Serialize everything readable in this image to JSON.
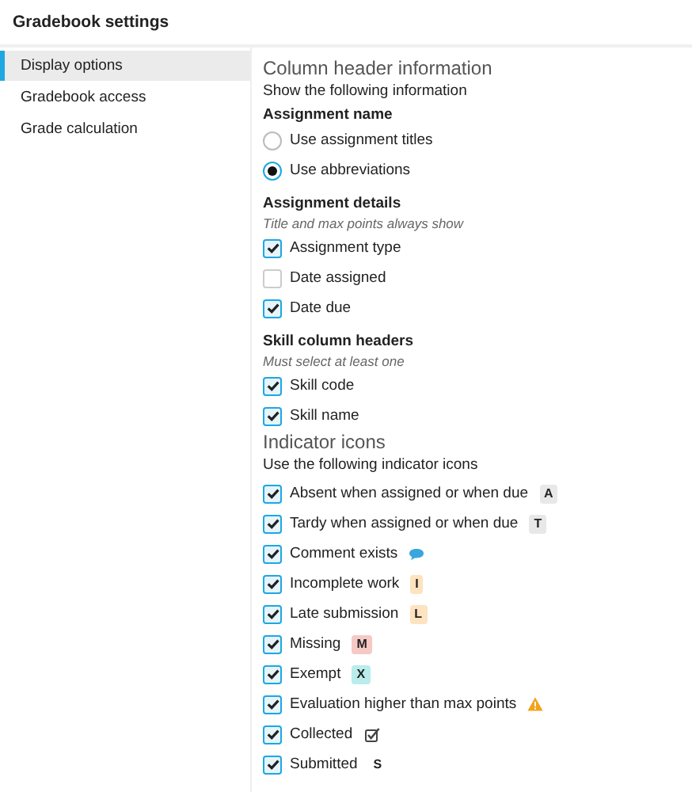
{
  "window": {
    "title": "Gradebook settings"
  },
  "sidebar": {
    "items": [
      {
        "label": "Display options",
        "selected": true
      },
      {
        "label": "Gradebook access",
        "selected": false
      },
      {
        "label": "Grade calculation",
        "selected": false
      }
    ]
  },
  "column_header": {
    "title": "Column header information",
    "subtitle": "Show the following information",
    "assignment_name": {
      "heading": "Assignment name",
      "options": [
        {
          "label": "Use assignment titles",
          "selected": false
        },
        {
          "label": "Use abbreviations",
          "selected": true
        }
      ]
    },
    "assignment_details": {
      "heading": "Assignment details",
      "note": "Title and max points always show",
      "options": [
        {
          "label": "Assignment type",
          "checked": true
        },
        {
          "label": "Date assigned",
          "checked": false
        },
        {
          "label": "Date due",
          "checked": true
        }
      ]
    },
    "skill_headers": {
      "heading": "Skill column headers",
      "note": "Must select at least one",
      "options": [
        {
          "label": "Skill code",
          "checked": true
        },
        {
          "label": "Skill name",
          "checked": true
        }
      ]
    }
  },
  "indicator_icons": {
    "title": "Indicator icons",
    "subtitle": "Use the following indicator icons",
    "options": [
      {
        "label": "Absent when assigned or when due",
        "checked": true,
        "kind": "badge",
        "badge": "A",
        "color": "#e8e8e8"
      },
      {
        "label": "Tardy when assigned or when due",
        "checked": true,
        "kind": "badge",
        "badge": "T",
        "color": "#e8e8e8"
      },
      {
        "label": "Comment exists",
        "checked": true,
        "kind": "comment"
      },
      {
        "label": "Incomplete work",
        "checked": true,
        "kind": "badge",
        "badge": "I",
        "color": "#fde3c0"
      },
      {
        "label": "Late submission",
        "checked": true,
        "kind": "badge",
        "badge": "L",
        "color": "#fde3c0"
      },
      {
        "label": "Missing",
        "checked": true,
        "kind": "badge",
        "badge": "M",
        "color": "#f6c9c4"
      },
      {
        "label": "Exempt",
        "checked": true,
        "kind": "badge",
        "badge": "X",
        "color": "#b9ecea"
      },
      {
        "label": "Evaluation higher than max points",
        "checked": true,
        "kind": "warning"
      },
      {
        "label": "Collected",
        "checked": true,
        "kind": "collected"
      },
      {
        "label": "Submitted",
        "checked": true,
        "kind": "letter",
        "badge": "S"
      }
    ]
  }
}
